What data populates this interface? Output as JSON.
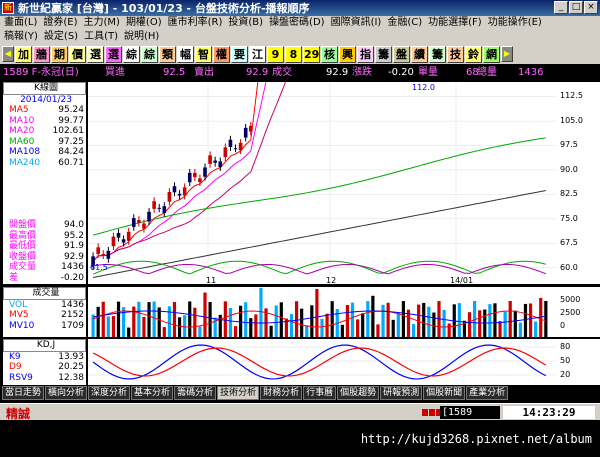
{
  "window": {
    "title": "新世紀贏家 [台灣] - 103/01/23 - 台盤技術分析-播報順序",
    "icon": "新"
  },
  "menu": {
    "row1": [
      "畫面(L)",
      "證券(E)",
      "主力(M)",
      "期權(O)",
      "匯市利率(R)",
      "投資(B)",
      "操盤密碼(D)",
      "國際資訊(I)",
      "金融(C)",
      "功能選擇(F)",
      "功能操作(E)"
    ],
    "row2": [
      "稿報(Y)",
      "設定(S)",
      "工具(T)",
      "說明(H)"
    ]
  },
  "toolbar": [
    {
      "label": "加",
      "color": "#ffff66"
    },
    {
      "label": "牆",
      "color": "#ff99cc"
    },
    {
      "label": "期",
      "color": "#ffcc66"
    },
    {
      "label": "價",
      "color": "#ffff99"
    },
    {
      "label": "選",
      "color": "#ffffcc"
    },
    {
      "label": "選",
      "color": "#ff66ff"
    },
    {
      "label": "綜",
      "color": "#ffffff"
    },
    {
      "label": "綜",
      "color": "#ccffcc"
    },
    {
      "label": "類",
      "color": "#ffcc99"
    },
    {
      "label": "幅",
      "color": "#ffffff"
    },
    {
      "label": "智",
      "color": "#ffff66"
    },
    {
      "label": "權",
      "color": "#ff9966"
    },
    {
      "label": "要",
      "color": "#ccffff"
    },
    {
      "label": "江",
      "color": "#ffffff"
    },
    {
      "label": "9",
      "color": "#ffff00"
    },
    {
      "label": "8",
      "color": "#ffff00"
    },
    {
      "label": "29",
      "color": "#ffff00"
    },
    {
      "label": "核",
      "color": "#99ff99"
    },
    {
      "label": "興",
      "color": "#ffcc00"
    },
    {
      "label": "指",
      "color": "#ffccff"
    },
    {
      "label": "籌",
      "color": "#cccccc"
    },
    {
      "label": "盤",
      "color": "#cccc99"
    },
    {
      "label": "續",
      "color": "#ffcc99"
    },
    {
      "label": "籌",
      "color": "#ccffcc"
    },
    {
      "label": "技",
      "color": "#ffcc99"
    },
    {
      "label": "鈴",
      "color": "#ffff66"
    },
    {
      "label": "網",
      "color": "#99ff66"
    }
  ],
  "quote": {
    "symbol": "1589 F-永冠(日)",
    "bid_label": "買進",
    "bid": "92.5",
    "ask_label": "賣出",
    "ask": "92.9",
    "last_label": "成交",
    "last": "92.9",
    "change_label": "漲跌",
    "change": "-0.20",
    "vol_label": "單量",
    "vol": "68",
    "total_label": "總量",
    "total": "1436"
  },
  "kline": {
    "header": "K線圖",
    "date": "2014/01/23",
    "ma": [
      {
        "label": "MA5",
        "value": "95.24",
        "color": "#ff0000"
      },
      {
        "label": "MA10",
        "value": "99.77",
        "color": "#ff00ff"
      },
      {
        "label": "MA20",
        "value": "102.61",
        "color": "#ff00ff"
      },
      {
        "label": "MA60",
        "value": "97.25",
        "color": "#00aa00"
      },
      {
        "label": "MA108",
        "value": "84.24",
        "color": "#0000ff"
      },
      {
        "label": "MA240",
        "value": "60.71",
        "color": "#00aaff"
      }
    ],
    "ohlc": [
      {
        "label": "開盤價",
        "value": "94.0"
      },
      {
        "label": "最高價",
        "value": "95.2"
      },
      {
        "label": "最低價",
        "value": "91.9"
      },
      {
        "label": "收盤價",
        "value": "92.9"
      },
      {
        "label": "成交量",
        "value": "1436"
      },
      {
        "label": "差",
        "value": "-0.20"
      }
    ],
    "yticks": [
      "112.5",
      "105.0",
      "97.5",
      "90.0",
      "82.5",
      "75.0",
      "67.5",
      "60.0"
    ],
    "xticks": [
      "11",
      "12",
      "14/01"
    ],
    "high_mark": "112.0",
    "low_mark": "61.5"
  },
  "volume": {
    "header": "成交量",
    "rows": [
      {
        "label": "VOL",
        "value": "1436",
        "color": "#00aaff"
      },
      {
        "label": "MV5",
        "value": "2152",
        "color": "#ff0000"
      },
      {
        "label": "MV10",
        "value": "1709",
        "color": "#0000ff"
      }
    ],
    "yticks": [
      "5000",
      "2500",
      "0"
    ]
  },
  "kd": {
    "header": "KD,J",
    "rows": [
      {
        "label": "K9",
        "value": "13.93",
        "color": "#0000ff"
      },
      {
        "label": "D9",
        "value": "20.25",
        "color": "#ff0000"
      },
      {
        "label": "RSV9",
        "value": "12.38",
        "color": "#0000ff"
      }
    ],
    "yticks": [
      "80",
      "50",
      "20"
    ]
  },
  "tabs": [
    "當日走勢",
    "橫向分析",
    "深度分析",
    "基本分析",
    "籌碼分析",
    "技術分析",
    "財務分析",
    "行事曆",
    "個股趨勢",
    "研報預測",
    "個股新聞",
    "產業分析"
  ],
  "active_tab": 5,
  "status": {
    "mode": "精誠",
    "code": "1589",
    "time": "14:23:29"
  },
  "watermark_url": "http://kujd3268.pixnet.net/album"
}
